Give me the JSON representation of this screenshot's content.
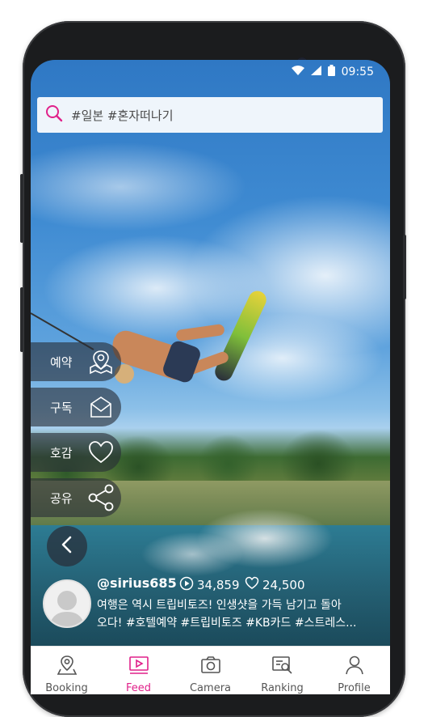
{
  "status_bar": {
    "time": "09:55"
  },
  "search": {
    "query": "#일본 #혼자떠나기"
  },
  "actions": [
    {
      "label": "예약",
      "icon": "map-pin-icon"
    },
    {
      "label": "구독",
      "icon": "mail-icon"
    },
    {
      "label": "호감",
      "icon": "heart-icon"
    },
    {
      "label": "공유",
      "icon": "share-icon"
    }
  ],
  "post": {
    "username": "@sirius685",
    "views": "34,859",
    "likes": "24,500",
    "caption_line1": "여행은 역시 트립비토즈! 인생샷을 가득 남기고 돌아",
    "caption_line2": "오다! #호텔예약 #트립비토즈 #KB카드 #스트레스..."
  },
  "nav": {
    "items": [
      {
        "label": "Booking",
        "icon": "location-pin-icon",
        "active": false
      },
      {
        "label": "Feed",
        "icon": "video-feed-icon",
        "active": true
      },
      {
        "label": "Camera",
        "icon": "camera-icon",
        "active": false
      },
      {
        "label": "Ranking",
        "icon": "ranking-search-icon",
        "active": false
      },
      {
        "label": "Profile",
        "icon": "person-icon",
        "active": false
      }
    ]
  },
  "colors": {
    "accent": "#e0218a",
    "pill_bg": "#282d37",
    "nav_text": "#555555"
  }
}
